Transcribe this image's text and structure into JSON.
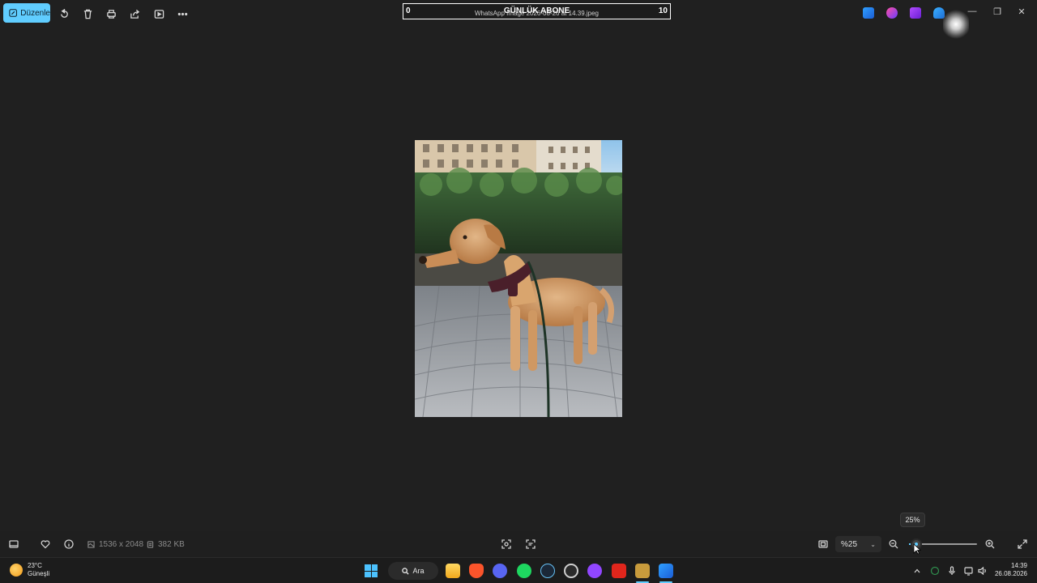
{
  "toolbar": {
    "edit_label": "Düzenle",
    "tools": [
      "rotate-icon",
      "delete-icon",
      "print-icon",
      "share-icon",
      "slideshow-icon",
      "more-icon"
    ]
  },
  "overlay": {
    "counter_left": "0",
    "caption": "GÜNLÜK ABONE",
    "counter_right": "10",
    "filename": "WhatsApp Image 2026-08-26 at 14.39.jpeg"
  },
  "window_controls": {
    "minimize": "—",
    "restore": "❐",
    "close": "✕"
  },
  "bottom_bar": {
    "dimensions": "1536 x 2048",
    "file_size": "382 KB",
    "zoom_value": "%25",
    "zoom_percent": 25,
    "zoom_tooltip": "25%"
  },
  "taskbar": {
    "weather_temp": "23°C",
    "weather_desc": "Güneşli",
    "search_label": "Ara",
    "time": "14:39",
    "date": "26.08.2026"
  },
  "colors": {
    "accent": "#60cdff",
    "background": "#202020"
  }
}
